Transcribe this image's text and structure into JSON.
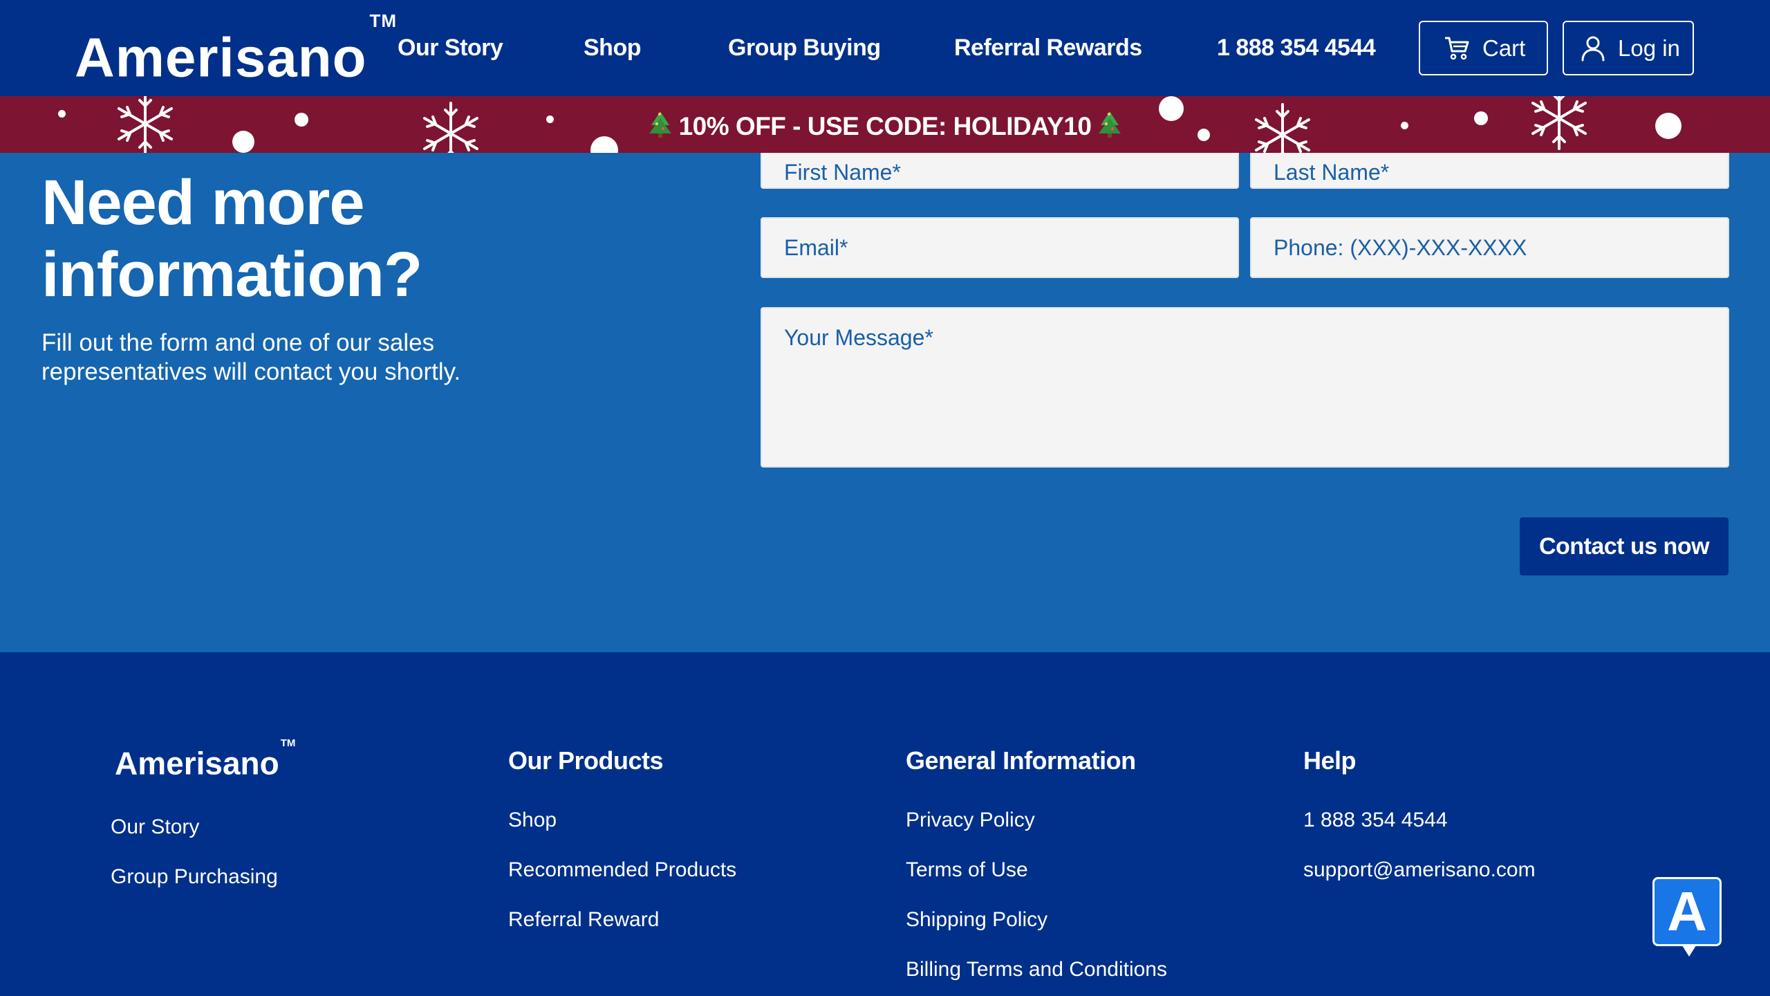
{
  "header": {
    "logo": "Amerisano",
    "logo_tm": "TM",
    "nav": [
      "Our Story",
      "Shop",
      "Group Buying",
      "Referral Rewards",
      "1 888 354 4544"
    ],
    "cart_label": "Cart",
    "login_label": "Log in"
  },
  "promo": {
    "text": "10% OFF - USE CODE: HOLIDAY10"
  },
  "contact": {
    "heading_line1": "Need more",
    "heading_line2": "information?",
    "subtext": "Fill out the form and one of our sales representatives will contact you shortly.",
    "first_name_placeholder": "First Name*",
    "last_name_placeholder": "Last Name*",
    "email_placeholder": "Email*",
    "phone_placeholder": "Phone: (XXX)-XXX-XXXX",
    "message_placeholder": "Your Message*",
    "submit_label": "Contact us now"
  },
  "footer": {
    "logo": "Amerisano",
    "logo_tm": "TM",
    "col1_links": [
      "Our Story",
      "Group Purchasing"
    ],
    "products_title": "Our Products",
    "products_links": [
      "Shop",
      "Recommended Products",
      "Referral Reward"
    ],
    "general_title": "General Information",
    "general_links": [
      "Privacy Policy",
      "Terms of Use",
      "Shipping Policy",
      "Billing Terms and Conditions"
    ],
    "help_title": "Help",
    "help_links": [
      "1 888 354 4544",
      "support@amerisano.com"
    ]
  },
  "chat_badge": "A",
  "colors": {
    "header_bg": "#00308a",
    "promo_bg": "#7d1432",
    "section_bg": "#1565b0",
    "footer_bg": "#00308a",
    "field_text": "#1a5fa8"
  }
}
